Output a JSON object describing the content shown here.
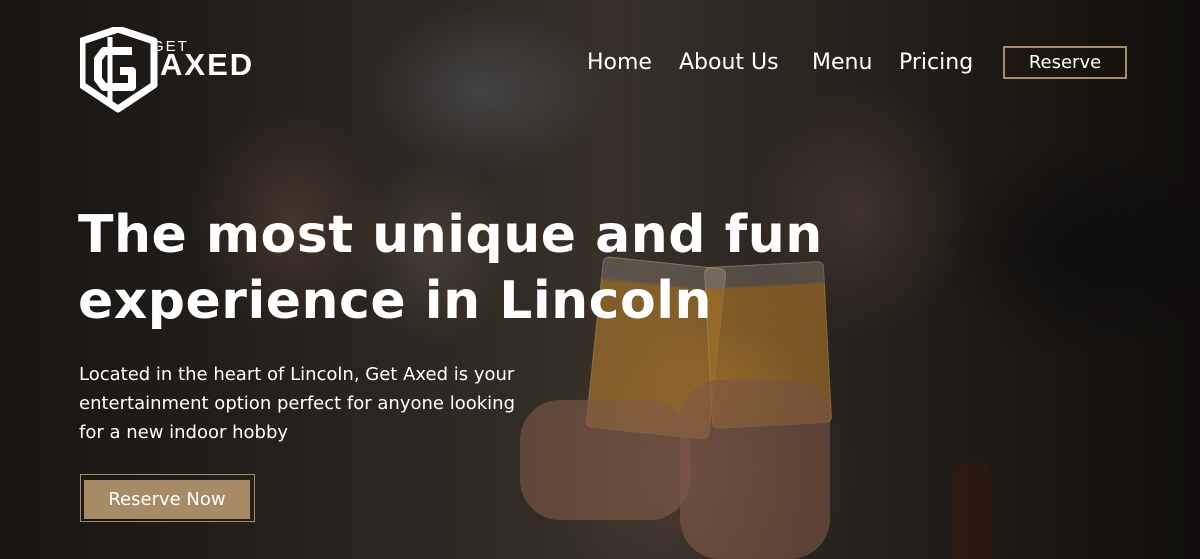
{
  "brand": {
    "logo_get": "GET",
    "logo_axed": "AXED"
  },
  "nav": {
    "items": [
      {
        "label": "Home"
      },
      {
        "label": "About Us"
      },
      {
        "label": "Menu"
      },
      {
        "label": "Pricing"
      }
    ],
    "reserve_label": "Reserve"
  },
  "hero": {
    "headline": "The most unique and fun experience in Lincoln",
    "subtext": "Located in the heart of Lincoln, Get Axed is your entertainment option perfect for anyone looking for a new indoor hobby",
    "cta_label": "Reserve Now"
  },
  "colors": {
    "accent": "#a68b66",
    "text": "#ffffff"
  }
}
